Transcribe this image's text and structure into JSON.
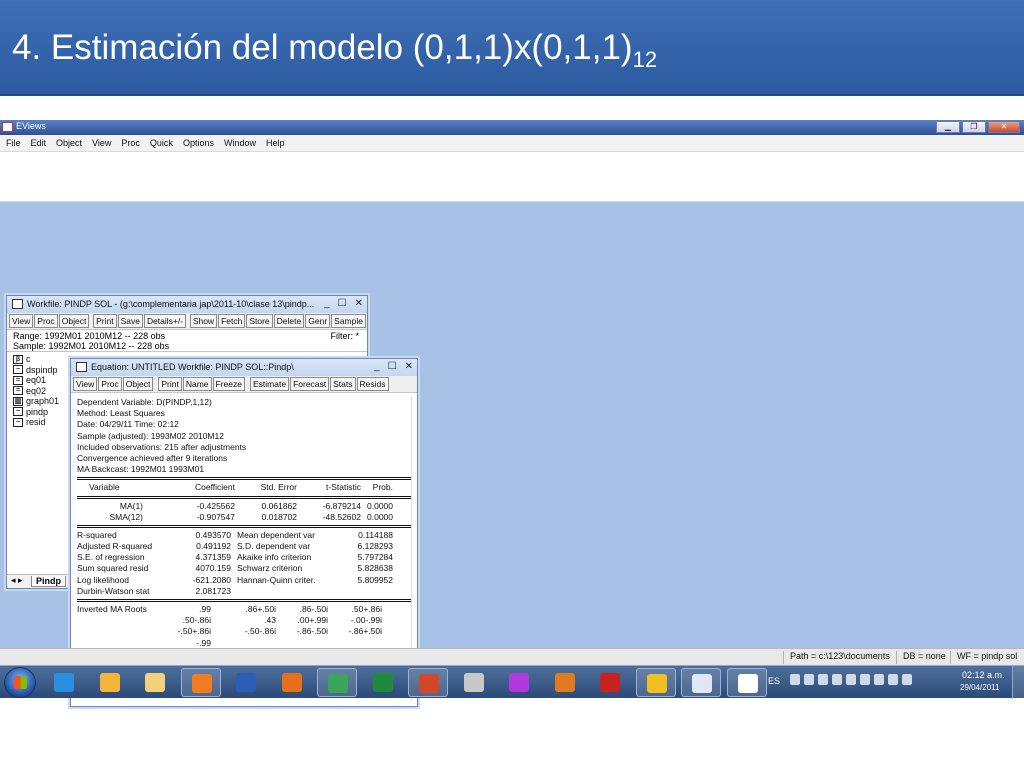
{
  "slide": {
    "title": "4. Estimación del modelo  (0,1,1)x(0,1,1)",
    "title_sub": "12"
  },
  "app": {
    "title": "EViews",
    "menu": [
      "File",
      "Edit",
      "Object",
      "View",
      "Proc",
      "Quick",
      "Options",
      "Window",
      "Help"
    ]
  },
  "workfile": {
    "title": "Workfile: PINDP SOL - (g:\\complementaria jap\\2011-10\\clase 13\\pindp...",
    "toolbar": [
      "View",
      "Proc",
      "Object",
      "Print",
      "Save",
      "Details+/-",
      "Show",
      "Fetch",
      "Store",
      "Delete",
      "Genr",
      "Sample"
    ],
    "range": "Range:  1992M01 2010M12  --   228 obs",
    "sample": "Sample: 1992M01 2010M12  --   228 obs",
    "filter": "Filter: *",
    "objects": [
      {
        "icon": "β",
        "name": "c"
      },
      {
        "icon": "~",
        "name": "dspindp"
      },
      {
        "icon": "=",
        "name": "eq01"
      },
      {
        "icon": "=",
        "name": "eq02"
      },
      {
        "icon": "▥",
        "name": "graph01"
      },
      {
        "icon": "~",
        "name": "pindp"
      },
      {
        "icon": "~",
        "name": "resid"
      }
    ],
    "tab": "Pindp"
  },
  "equation": {
    "title": "Equation: UNTITLED   Workfile: PINDP SOL::Pindp\\",
    "toolbar": [
      "View",
      "Proc",
      "Object",
      "Print",
      "Name",
      "Freeze",
      "Estimate",
      "Forecast",
      "Stats",
      "Resids"
    ],
    "header": [
      "Dependent Variable: D(PINDP,1,12)",
      "Method: Least Squares",
      "Date: 04/29/11   Time: 02:12",
      "Sample (adjusted): 1993M02 2010M12",
      "Included observations: 215 after adjustments",
      "Convergence achieved after 9 iterations",
      "MA Backcast: 1992M01 1993M01"
    ],
    "columns": [
      "Variable",
      "Coefficient",
      "Std. Error",
      "t-Statistic",
      "Prob."
    ],
    "coef_rows": [
      [
        "MA(1)",
        "-0.425562",
        "0.061862",
        "-6.879214",
        "0.0000"
      ],
      [
        "SMA(12)",
        "-0.907547",
        "0.018702",
        "-48.52602",
        "0.0000"
      ]
    ],
    "stats_rows": [
      [
        "R-squared",
        "0.493570",
        "Mean dependent var",
        "0.114188"
      ],
      [
        "Adjusted R-squared",
        "0.491192",
        "S.D. dependent var",
        "6.128293"
      ],
      [
        "S.E. of regression",
        "4.371359",
        "Akaike info criterion",
        "5.797284"
      ],
      [
        "Sum squared resid",
        "4070.159",
        "Schwarz criterion",
        "5.828638"
      ],
      [
        "Log likelihood",
        "-621.2080",
        "Hannan-Quinn criter.",
        "5.809952"
      ],
      [
        "Durbin-Watson stat",
        "2.081723",
        "",
        ""
      ]
    ],
    "roots_label": "Inverted MA Roots",
    "roots_rows": [
      [
        ".99",
        ".86+.50i",
        ".86-.50i",
        ".50+.86i"
      ],
      [
        ".50-.86i",
        ".43",
        ".00+.99i",
        "-.00-.99i"
      ],
      [
        "-.50+.86i",
        "-.50-.86i",
        "-.86-.50i",
        "-.86+.50i"
      ],
      [
        "-.99",
        "",
        "",
        ""
      ]
    ]
  },
  "statusbar": {
    "path": "Path = c:\\123\\documents",
    "db": "DB = none",
    "wf": "WF = pindp sol"
  },
  "taskbar": {
    "apps": [
      {
        "name": "ie-icon",
        "color": "#2a8fe0"
      },
      {
        "name": "outlook-icon",
        "color": "#f3b53a"
      },
      {
        "name": "explorer-folder-icon",
        "color": "#f1d27a"
      },
      {
        "name": "media-player-icon",
        "color": "#f07b22"
      },
      {
        "name": "word-icon",
        "color": "#2b5fb5"
      },
      {
        "name": "firefox-icon",
        "color": "#e7711b"
      },
      {
        "name": "chrome-icon",
        "color": "#3ba55c"
      },
      {
        "name": "excel-icon",
        "color": "#1f8a3a"
      },
      {
        "name": "powerpoint-icon",
        "color": "#d24726"
      },
      {
        "name": "calendar-app-icon",
        "color": "#c8c8c8"
      },
      {
        "name": "virus-app-icon",
        "color": "#b03adf"
      },
      {
        "name": "matlab-icon",
        "color": "#e27a20"
      },
      {
        "name": "acrobat-icon",
        "color": "#c8221f"
      },
      {
        "name": "media-eye-icon",
        "color": "#f0c020"
      },
      {
        "name": "paint-icon",
        "color": "#e0e8f5"
      },
      {
        "name": "eviews-icon",
        "color": "#ffffff"
      }
    ],
    "lang": "ES",
    "time": "02:12 a.m.",
    "date": "29/04/2011"
  }
}
